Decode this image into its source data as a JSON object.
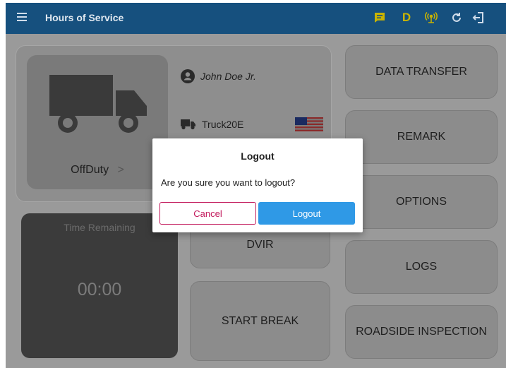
{
  "appbar": {
    "title": "Hours of Service",
    "duty_indicator": "D",
    "icons": [
      "menu-icon",
      "message-icon",
      "connection-icon",
      "refresh-icon",
      "logout-icon"
    ]
  },
  "driver": {
    "name": "John Doe Jr.",
    "vehicle": "Truck20E",
    "status": "OffDuty",
    "status_chevron": ">"
  },
  "time_remaining": {
    "label": "Time Remaining",
    "value": "00:00"
  },
  "buttons": {
    "data_transfer": "DATA TRANSFER",
    "remark": "REMARK",
    "options": "OPTIONS",
    "logs": "LOGS",
    "roadside_inspection": "ROADSIDE INSPECTION",
    "dvir": "DVIR",
    "start_break": "START BREAK"
  },
  "dialog": {
    "title": "Logout",
    "message": "Are you sure you want to logout?",
    "cancel_label": "Cancel",
    "confirm_label": "Logout"
  },
  "colors": {
    "appbar": "#16507e",
    "accent": "#2f99e6",
    "cancel": "#c2185b",
    "duty_indicator": "#c9b300"
  }
}
